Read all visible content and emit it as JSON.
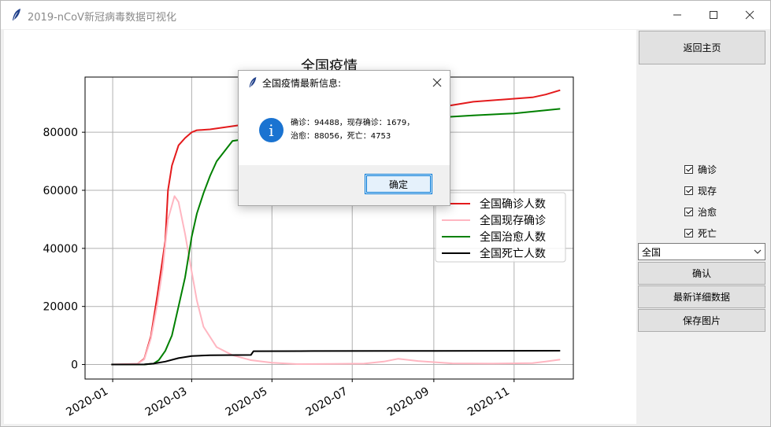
{
  "window": {
    "title": "2019-nCoV新冠病毒数据可视化",
    "controls": [
      "minimize",
      "maximize",
      "close"
    ],
    "app_icon": "feather-icon"
  },
  "sidebar": {
    "home_button": "返回主页",
    "checkboxes": [
      {
        "label": "确诊",
        "checked": true
      },
      {
        "label": "现存",
        "checked": true
      },
      {
        "label": "治愈",
        "checked": true
      },
      {
        "label": "死亡",
        "checked": true
      }
    ],
    "region_select": {
      "value": "全国"
    },
    "confirm_button": "确认",
    "latest_button": "最新详细数据",
    "save_button": "保存图片"
  },
  "dialog": {
    "title": "全国疫情最新信息:",
    "message_line1": "确诊：94488，现存确诊：1679，",
    "message_line2": "治愈：88056，死亡：4753",
    "ok_button": "确定"
  },
  "chart_data": {
    "type": "line",
    "title": "全国疫情",
    "xlabel": "",
    "ylabel": "",
    "x_ticks": [
      "2020-01",
      "2020-03",
      "2020-05",
      "2020-07",
      "2020-09",
      "2020-11"
    ],
    "y_ticks": [
      0,
      20000,
      40000,
      60000,
      80000
    ],
    "ylim": [
      -5000,
      99000
    ],
    "xlim": [
      "2019-12-11",
      "2020-12-16"
    ],
    "grid": true,
    "legend_position": "center-right",
    "series": [
      {
        "name": "全国确诊人数",
        "color": "#e41a1c",
        "points": [
          [
            "2019-12-31",
            0
          ],
          [
            "2020-01-15",
            50
          ],
          [
            "2020-01-20",
            300
          ],
          [
            "2020-01-25",
            2000
          ],
          [
            "2020-01-30",
            9700
          ],
          [
            "2020-02-04",
            24000
          ],
          [
            "2020-02-10",
            42600
          ],
          [
            "2020-02-12",
            60000
          ],
          [
            "2020-02-15",
            68500
          ],
          [
            "2020-02-20",
            75500
          ],
          [
            "2020-02-25",
            78000
          ],
          [
            "2020-03-01",
            80000
          ],
          [
            "2020-03-05",
            80700
          ],
          [
            "2020-03-15",
            81000
          ],
          [
            "2020-04-15",
            83000
          ],
          [
            "2020-06-01",
            84000
          ],
          [
            "2020-08-01",
            86000
          ],
          [
            "2020-10-01",
            90500
          ],
          [
            "2020-11-15",
            92000
          ],
          [
            "2020-11-25",
            93000
          ],
          [
            "2020-12-06",
            94488
          ]
        ]
      },
      {
        "name": "全国现存确诊",
        "color": "#ffb6c1",
        "points": [
          [
            "2019-12-31",
            0
          ],
          [
            "2020-01-20",
            300
          ],
          [
            "2020-01-25",
            1800
          ],
          [
            "2020-01-30",
            9000
          ],
          [
            "2020-02-04",
            21000
          ],
          [
            "2020-02-08",
            33000
          ],
          [
            "2020-02-12",
            50000
          ],
          [
            "2020-02-17",
            58000
          ],
          [
            "2020-02-20",
            56000
          ],
          [
            "2020-02-25",
            45000
          ],
          [
            "2020-03-01",
            32000
          ],
          [
            "2020-03-05",
            22000
          ],
          [
            "2020-03-10",
            13000
          ],
          [
            "2020-03-20",
            6000
          ],
          [
            "2020-04-01",
            3200
          ],
          [
            "2020-04-15",
            1500
          ],
          [
            "2020-05-01",
            600
          ],
          [
            "2020-05-20",
            150
          ],
          [
            "2020-06-15",
            200
          ],
          [
            "2020-07-10",
            300
          ],
          [
            "2020-07-25",
            1000
          ],
          [
            "2020-08-05",
            2000
          ],
          [
            "2020-08-20",
            1200
          ],
          [
            "2020-09-15",
            400
          ],
          [
            "2020-10-15",
            300
          ],
          [
            "2020-11-15",
            500
          ],
          [
            "2020-11-25",
            1000
          ],
          [
            "2020-12-06",
            1679
          ]
        ]
      },
      {
        "name": "全国治愈人数",
        "color": "#008000",
        "points": [
          [
            "2019-12-31",
            0
          ],
          [
            "2020-01-25",
            0
          ],
          [
            "2020-02-01",
            300
          ],
          [
            "2020-02-05",
            1500
          ],
          [
            "2020-02-10",
            4700
          ],
          [
            "2020-02-15",
            10000
          ],
          [
            "2020-02-20",
            20000
          ],
          [
            "2020-02-25",
            30000
          ],
          [
            "2020-03-01",
            44000
          ],
          [
            "2020-03-05",
            52000
          ],
          [
            "2020-03-10",
            59000
          ],
          [
            "2020-03-15",
            65000
          ],
          [
            "2020-03-20",
            70000
          ],
          [
            "2020-04-01",
            77000
          ],
          [
            "2020-05-01",
            79000
          ],
          [
            "2020-07-01",
            79500
          ],
          [
            "2020-08-01",
            84000
          ],
          [
            "2020-09-01",
            85000
          ],
          [
            "2020-10-01",
            85800
          ],
          [
            "2020-11-01",
            86500
          ],
          [
            "2020-12-06",
            88056
          ]
        ]
      },
      {
        "name": "全国死亡人数",
        "color": "#000000",
        "points": [
          [
            "2019-12-31",
            0
          ],
          [
            "2020-01-25",
            50
          ],
          [
            "2020-02-01",
            300
          ],
          [
            "2020-02-10",
            1000
          ],
          [
            "2020-02-20",
            2200
          ],
          [
            "2020-03-01",
            2900
          ],
          [
            "2020-03-15",
            3200
          ],
          [
            "2020-04-15",
            3300
          ],
          [
            "2020-04-17",
            4600
          ],
          [
            "2020-06-01",
            4630
          ],
          [
            "2020-09-01",
            4700
          ],
          [
            "2020-12-06",
            4753
          ]
        ]
      }
    ]
  }
}
